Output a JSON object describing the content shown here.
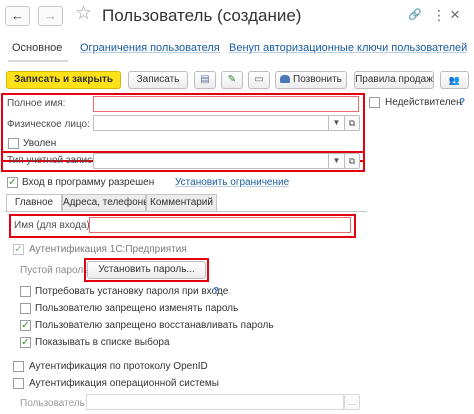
{
  "window": {
    "title": "Пользователь (создание)",
    "nav_back": "←",
    "nav_forward": "→",
    "star": "☆",
    "link_icon": "🔗",
    "more": "⋮",
    "close": "×"
  },
  "tabs": {
    "main": "Основное",
    "restrictions": "Ограничения пользователя",
    "keys": "Венуп авторизационные ключи пользователей"
  },
  "toolbar": {
    "save_close": "Записать и закрыть",
    "save": "Записать",
    "list_icon": "▤",
    "pen_icon": "✎",
    "chat_icon": "▭",
    "call": "Позвонить",
    "sale_rules": "Правила продаж",
    "users_icon": "👥"
  },
  "form": {
    "full_name_label": "Полное имя:",
    "full_name_value": "",
    "individual_label": "Физическое лицо:",
    "individual_value": "",
    "inactive_label": "Недействителен",
    "fired_label": "Уволен",
    "account_type_label": "Тип учетной записи:",
    "account_type_value": "",
    "login_allowed_label": "Вход в программу разрешен",
    "set_restriction_link": "Установить ограничение",
    "help": "?"
  },
  "form_tabs": {
    "main": "Главное",
    "addresses": "Адреса, телефоны",
    "comment": "Комментарий"
  },
  "auth": {
    "login_name_label": "Имя (для входа):",
    "login_name_value": "",
    "auth_1c_label": "Аутентификация 1С:Предприятия",
    "empty_password_label": "Пустой пароль",
    "set_password_button": "Установить пароль...",
    "require_password_label": "Потребовать установку пароля при входе",
    "deny_change_label": "Пользователю запрещено изменять пароль",
    "deny_restore_label": "Пользователю запрещено восстанавливать пароль",
    "show_in_list_label": "Показывать в списке выбора",
    "openid_label": "Аутентификация по протоколу OpenID",
    "os_auth_label": "Аутентификация операционной системы",
    "user_label": "Пользователь:",
    "user_value": ""
  },
  "colors": {
    "accent_yellow": "#ffe11a",
    "highlight_red": "#e3000f",
    "link_blue": "#1a5a9c",
    "check_green": "#3c8a2e"
  }
}
